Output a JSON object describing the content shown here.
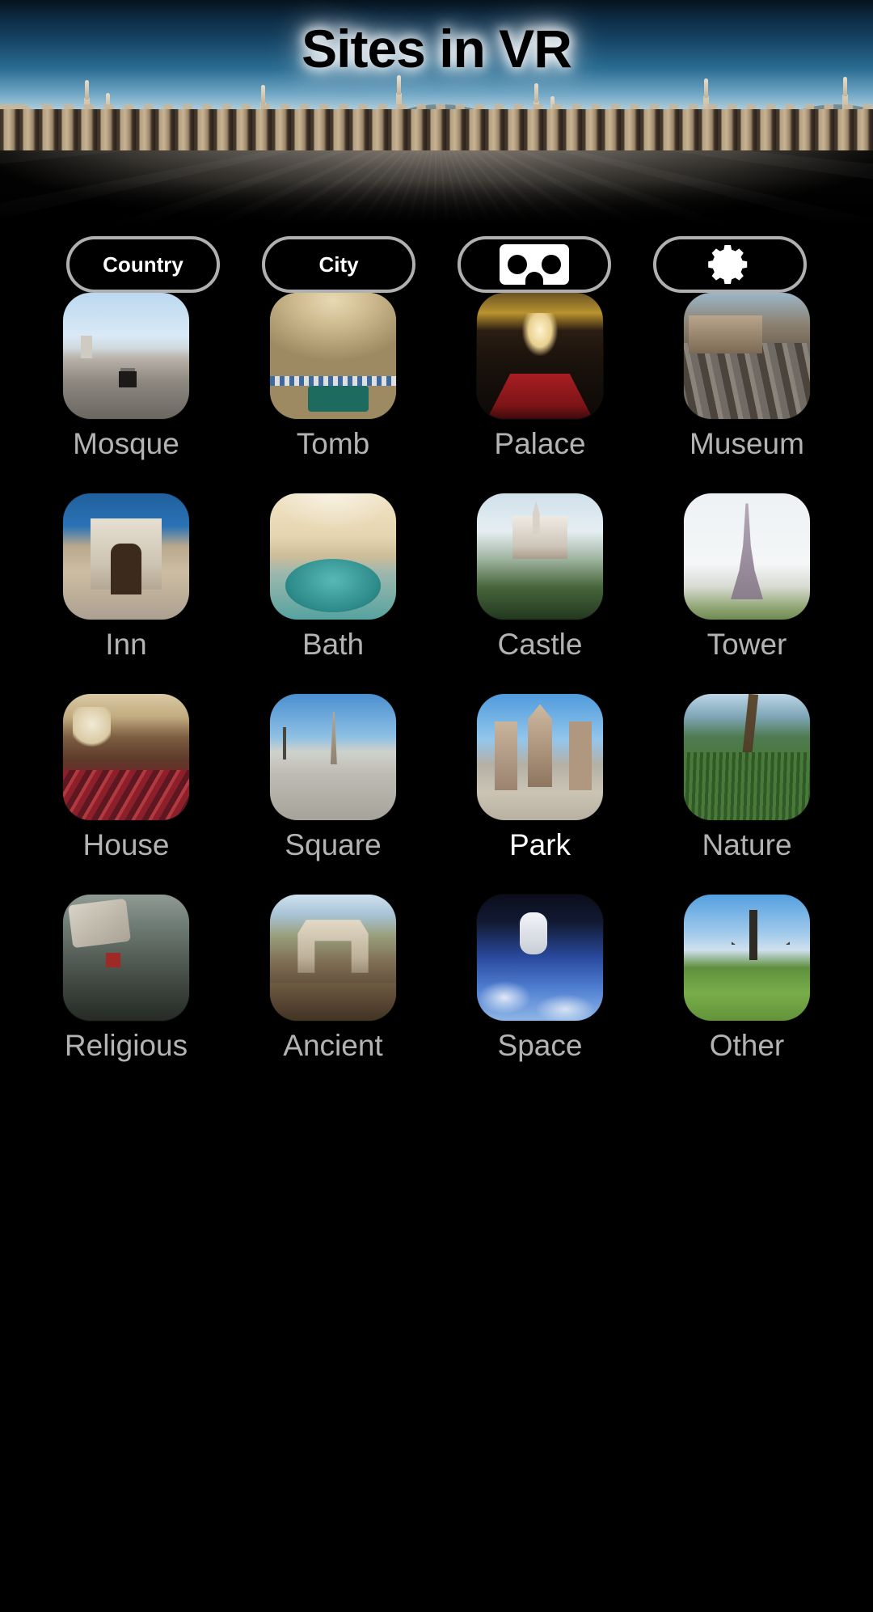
{
  "app": {
    "title": "Sites in VR",
    "background_color": "#000000",
    "label_color": "#b3b3b3",
    "selected_label_color": "#ffffff",
    "pill_border_color": "#b0b0b0"
  },
  "header": {
    "title": "Sites in VR",
    "banner_alt": "mosque-courtyard-panorama"
  },
  "toolbar": {
    "buttons": [
      {
        "label": "Country",
        "icon": "",
        "type": "text",
        "name": "country-button"
      },
      {
        "label": "City",
        "icon": "",
        "type": "text",
        "name": "city-button"
      },
      {
        "label": "",
        "icon": "vr-cardboard-icon",
        "type": "icon",
        "name": "vr-mode-button"
      },
      {
        "label": "",
        "icon": "gear-icon",
        "type": "icon",
        "name": "settings-button"
      }
    ]
  },
  "grid": {
    "columns": 4,
    "items": [
      {
        "label": "Mosque",
        "thumb": "mosque-thumb",
        "selected": false
      },
      {
        "label": "Tomb",
        "thumb": "tomb-thumb",
        "selected": false
      },
      {
        "label": "Palace",
        "thumb": "palace-thumb",
        "selected": false
      },
      {
        "label": "Museum",
        "thumb": "museum-thumb",
        "selected": false
      },
      {
        "label": "Inn",
        "thumb": "inn-thumb",
        "selected": false
      },
      {
        "label": "Bath",
        "thumb": "bath-thumb",
        "selected": false
      },
      {
        "label": "Castle",
        "thumb": "castle-thumb",
        "selected": false
      },
      {
        "label": "Tower",
        "thumb": "tower-thumb",
        "selected": false
      },
      {
        "label": "House",
        "thumb": "house-thumb",
        "selected": false
      },
      {
        "label": "Square",
        "thumb": "square-thumb",
        "selected": false
      },
      {
        "label": "Park",
        "thumb": "park-thumb",
        "selected": true
      },
      {
        "label": "Nature",
        "thumb": "nature-thumb",
        "selected": false
      },
      {
        "label": "Religious",
        "thumb": "religious-thumb",
        "selected": false
      },
      {
        "label": "Ancient",
        "thumb": "ancient-thumb",
        "selected": false
      },
      {
        "label": "Space",
        "thumb": "space-thumb",
        "selected": false
      },
      {
        "label": "Other",
        "thumb": "other-thumb",
        "selected": false
      }
    ]
  }
}
